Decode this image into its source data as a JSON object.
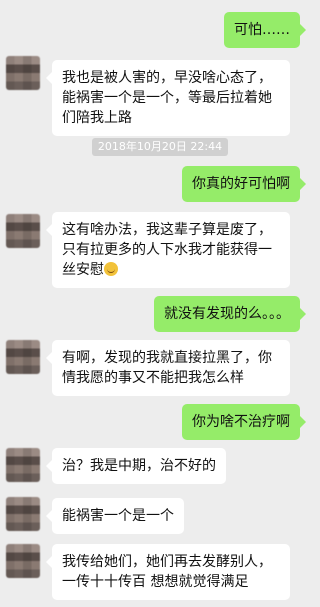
{
  "messages": [
    {
      "side": "right",
      "text": "可怕……"
    },
    {
      "side": "left",
      "text": "我也是被人害的，早没啥心态了，能祸害一个是一个，等最后拉着她们陪我上路"
    },
    {
      "side": "time",
      "text": "2018年10月20日 22:44"
    },
    {
      "side": "right",
      "text": "你真的好可怕啊"
    },
    {
      "side": "left",
      "text": "这有啥办法，我这辈子算是废了，只有拉更多的人下水我才能获得一丝安慰",
      "emoji": "grin-emoji"
    },
    {
      "side": "right",
      "text": "就没有发现的么。。。"
    },
    {
      "side": "left",
      "text": "有啊，发现的我就直接拉黑了，你情我愿的事又不能把我怎么样"
    },
    {
      "side": "right",
      "text": "你为啥不治疗啊"
    },
    {
      "side": "left",
      "text": "治？我是中期，治不好的"
    },
    {
      "side": "left",
      "text": "能祸害一个是一个"
    },
    {
      "side": "left",
      "text": "我传给她们，她们再去发酵别人，一传十十传百 想想就觉得满足"
    }
  ],
  "colors": {
    "background": "#ededed",
    "bubble_self": "#95ec69",
    "bubble_other": "#ffffff",
    "time_badge": "#d0d0d0"
  }
}
